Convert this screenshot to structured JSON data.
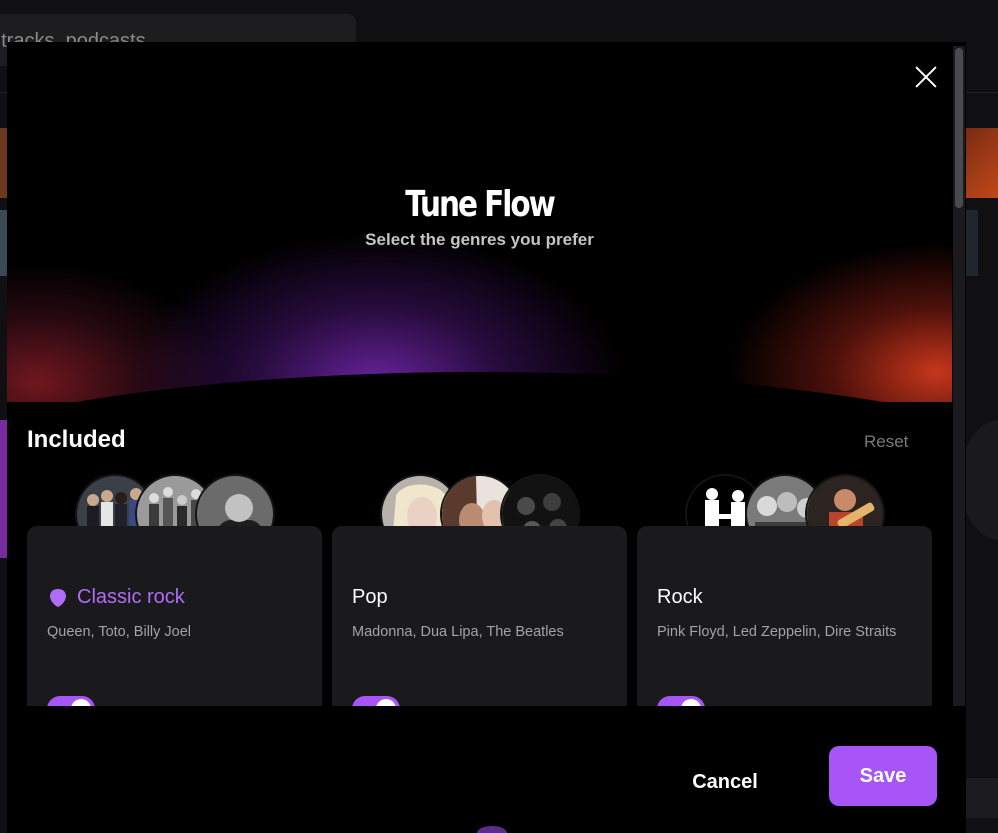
{
  "background": {
    "search_placeholder": "s, tracks, podcasts"
  },
  "modal": {
    "title": "Tune Flow",
    "subtitle": "Select the genres you prefer",
    "section_title": "Included",
    "reset_label": "Reset",
    "close_icon": "close-icon",
    "genres": [
      {
        "name": "Classic rock",
        "artists": "Queen, Toto, Billy Joel",
        "active": true,
        "icon": "guitar-pick-icon",
        "enabled": true,
        "avatar_colors": [
          "#2b2f36",
          "#8f8f8f",
          "#3a3a3a"
        ]
      },
      {
        "name": "Pop",
        "artists": "Madonna, Dua Lipa, The Beatles",
        "active": false,
        "enabled": true,
        "avatar_colors": [
          "#c9b7a8",
          "#8c6a5c",
          "#2a2a2a"
        ]
      },
      {
        "name": "Rock",
        "artists": "Pink Floyd, Led Zeppelin, Dire Straits",
        "active": false,
        "enabled": true,
        "avatar_colors": [
          "#e8e8e8",
          "#6e6e6e",
          "#8b4a2e"
        ]
      }
    ],
    "footer": {
      "cancel_label": "Cancel",
      "save_label": "Save"
    }
  },
  "colors": {
    "accent": "#a855f7",
    "active_text": "#b06cf6",
    "card_bg": "#1a191c",
    "muted_text": "#a3a3a3"
  }
}
